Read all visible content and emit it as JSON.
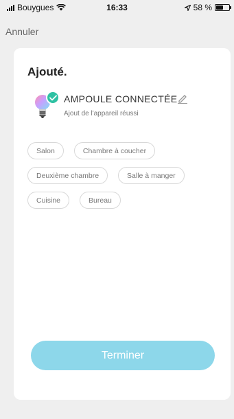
{
  "status_bar": {
    "carrier": "Bouygues",
    "time": "16:33",
    "battery": "58 %",
    "battery_level": 0.58
  },
  "nav": {
    "cancel_label": "Annuler"
  },
  "card": {
    "title": "Ajouté.",
    "device": {
      "name": "AMPOULE CONNECTÉE",
      "status": "Ajout de l'appareil réussi",
      "icon": "smart-bulb-icon",
      "check_color": "#2ec1a3"
    },
    "rooms": [
      [
        "Salon",
        "Chambre à coucher"
      ],
      [
        "Deuxième chambre",
        "Salle à manger"
      ],
      [
        "Cuisine",
        "Bureau"
      ]
    ],
    "done_label": "Terminer",
    "done_color": "#8dd7ea"
  }
}
